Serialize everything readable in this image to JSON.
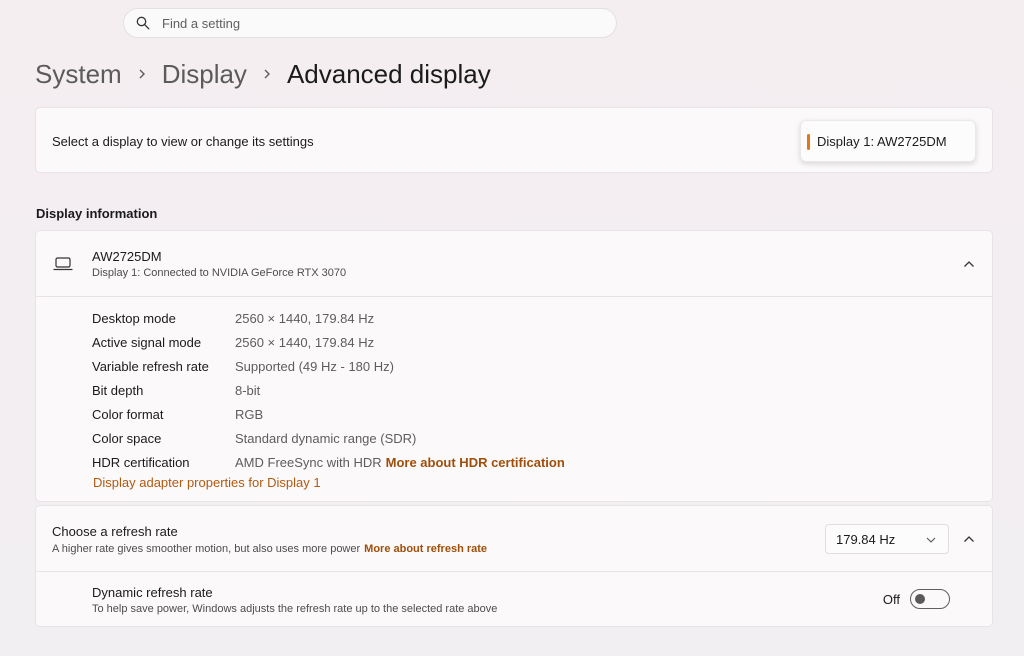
{
  "search": {
    "placeholder": "Find a setting",
    "icon": "search-icon"
  },
  "breadcrumb": {
    "items": [
      "System",
      "Display"
    ],
    "current": "Advanced display"
  },
  "display_select": {
    "label": "Select a display to view or change its settings",
    "selected": "Display 1: AW2725DM",
    "accent_color": "#e0771a"
  },
  "display_info": {
    "section_title": "Display information",
    "monitor_name": "AW2725DM",
    "connection": "Display 1: Connected to NVIDIA GeForce RTX 3070",
    "expanded": true,
    "rows": [
      {
        "key": "Desktop mode",
        "value": "2560 × 1440, 179.84 Hz"
      },
      {
        "key": "Active signal mode",
        "value": "2560 × 1440, 179.84 Hz"
      },
      {
        "key": "Variable refresh rate",
        "value": "Supported (49 Hz - 180 Hz)"
      },
      {
        "key": "Bit depth",
        "value": "8-bit"
      },
      {
        "key": "Color format",
        "value": "RGB"
      },
      {
        "key": "Color space",
        "value": "Standard dynamic range (SDR)"
      },
      {
        "key": "HDR certification",
        "value": "AMD FreeSync with HDR",
        "link": "More about HDR certification"
      }
    ],
    "adapter_link": "Display adapter properties for Display 1"
  },
  "refresh_rate": {
    "title": "Choose a refresh rate",
    "description": "A higher rate gives smoother motion, but also uses more power",
    "link": "More about refresh rate",
    "selected_rate": "179.84 Hz",
    "dynamic": {
      "title": "Dynamic refresh rate",
      "description": "To help save power, Windows adjusts the refresh rate up to the selected rate above",
      "state_label": "Off",
      "enabled": false
    }
  },
  "colors": {
    "link": "#a04f0a",
    "accent": "#e0771a"
  }
}
